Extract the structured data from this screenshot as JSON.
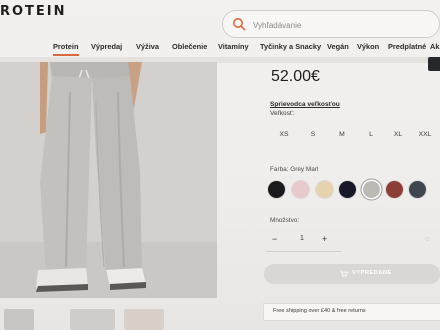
{
  "header": {
    "logo_text": "ROTEIN",
    "search": {
      "placeholder": "Vyhľadávanie"
    }
  },
  "nav": {
    "items": [
      {
        "label": "Protein",
        "active": true
      },
      {
        "label": "Výpredaj"
      },
      {
        "label": "Výživa"
      },
      {
        "label": "Oblečenie"
      },
      {
        "label": "Vitamíny"
      },
      {
        "label": "Tyčinky a Snacky"
      },
      {
        "label": "Vegán"
      },
      {
        "label": "Výkon"
      },
      {
        "label": "Predplatné"
      },
      {
        "label": "Ak"
      }
    ]
  },
  "product": {
    "price": "52.00€",
    "size_guide": "Sprievodca veľkosťou",
    "size_label": "Veľkosť:",
    "sizes": [
      "XS",
      "S",
      "M",
      "L",
      "XL",
      "XXL"
    ],
    "color_label": "Farba: Grey Marl",
    "swatches": [
      {
        "name": "black",
        "color": "#1b1b1d"
      },
      {
        "name": "pink",
        "color": "#e8c9cc"
      },
      {
        "name": "beige",
        "color": "#e6d2ad"
      },
      {
        "name": "navy",
        "color": "#17192a"
      },
      {
        "name": "grey-marl",
        "color": "#bdbab6",
        "selected": true
      },
      {
        "name": "rust",
        "color": "#8c3f36"
      },
      {
        "name": "slate",
        "color": "#3f4650"
      }
    ],
    "quantity_label": "Množstvo:",
    "quantity_minus": "−",
    "quantity_value": "1",
    "quantity_plus": "+",
    "buy_button": "VYPREDANÉ",
    "shipping_text": "Free shipping over £40 & free returns"
  },
  "colors": {
    "accent": "#d96a3f",
    "button_disabled": "#d9d6d3"
  }
}
